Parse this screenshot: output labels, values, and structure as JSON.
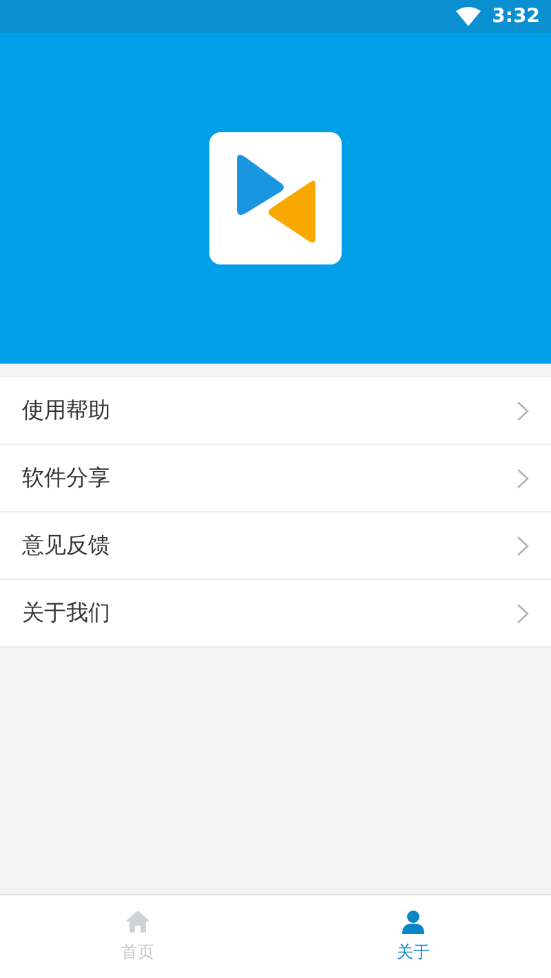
{
  "status_bar": {
    "time": "3:32"
  },
  "menu": [
    {
      "label": "使用帮助"
    },
    {
      "label": "软件分享"
    },
    {
      "label": "意见反馈"
    },
    {
      "label": "关于我们"
    }
  ],
  "tab_bar": [
    {
      "label": "首页",
      "kind": "home",
      "selected": false
    },
    {
      "label": "关于",
      "kind": "profile",
      "selected": true
    }
  ]
}
